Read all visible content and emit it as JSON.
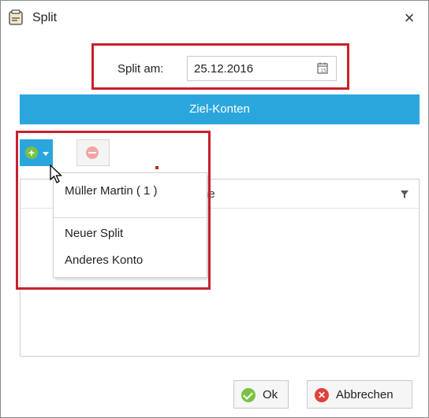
{
  "window": {
    "title": "Split",
    "close_glyph": "×"
  },
  "date": {
    "label": "Split am:",
    "value": "25.12.2016",
    "icon": "calendar-icon"
  },
  "ziel": {
    "label": "Ziel-Konten"
  },
  "toolbar": {
    "add_icon": "add-circle-icon",
    "add_dropdown_icon": "chevron-down-icon",
    "remove_icon": "remove-circle-icon"
  },
  "list": {
    "header_partial": "ne",
    "filter_icon": "filter-icon"
  },
  "dropdown": {
    "items": [
      {
        "label": "Müller Martin ( 1 )"
      },
      {
        "label": "Neuer Split"
      },
      {
        "label": "Anderes Konto"
      }
    ]
  },
  "footer": {
    "ok_label": "Ok",
    "cancel_label": "Abbrechen"
  },
  "colors": {
    "accent": "#2ba6dd",
    "annotation": "#c8202c",
    "ok_green": "#7ac143",
    "cancel_red": "#e0413a"
  }
}
